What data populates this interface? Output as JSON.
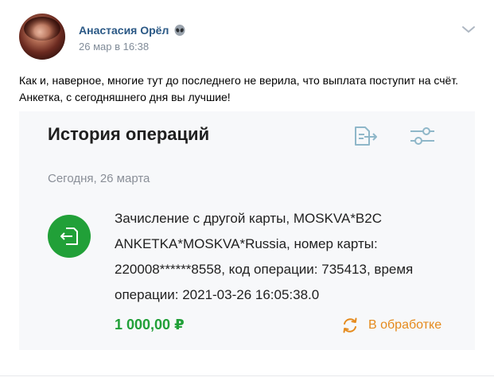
{
  "post": {
    "author": "Анастасия Орёл",
    "date": "26 мар в 16:38",
    "text": "Как и, наверное, многие тут до последнего не верила, что выплата поступит на счёт. Анкетка, с сегодняшнего дня вы лучшие!"
  },
  "attachment": {
    "title": "История операций",
    "date_label": "Сегодня, 26 марта",
    "operation": {
      "description": "Зачисление с другой карты, MOSKVA*B2C ANKETKA*MOSKVA*Russia, номер карты: 220008******8558, код операции: 735413, время операции: 2021-03-26 16:05:38.0",
      "amount": "1 000,00 ₽",
      "status": "В обработке"
    }
  },
  "icons": {
    "author_badge": "alien-icon",
    "menu": "chevron-down-icon",
    "export": "export-icon",
    "filter": "filter-sliders-icon",
    "operation": "incoming-transfer-icon",
    "status": "refresh-icon"
  },
  "colors": {
    "link": "#2a5885",
    "accent_green": "#21a038",
    "pending_orange": "#e58a1c",
    "icon_teal": "#8fb7c9",
    "muted": "#818c99"
  }
}
